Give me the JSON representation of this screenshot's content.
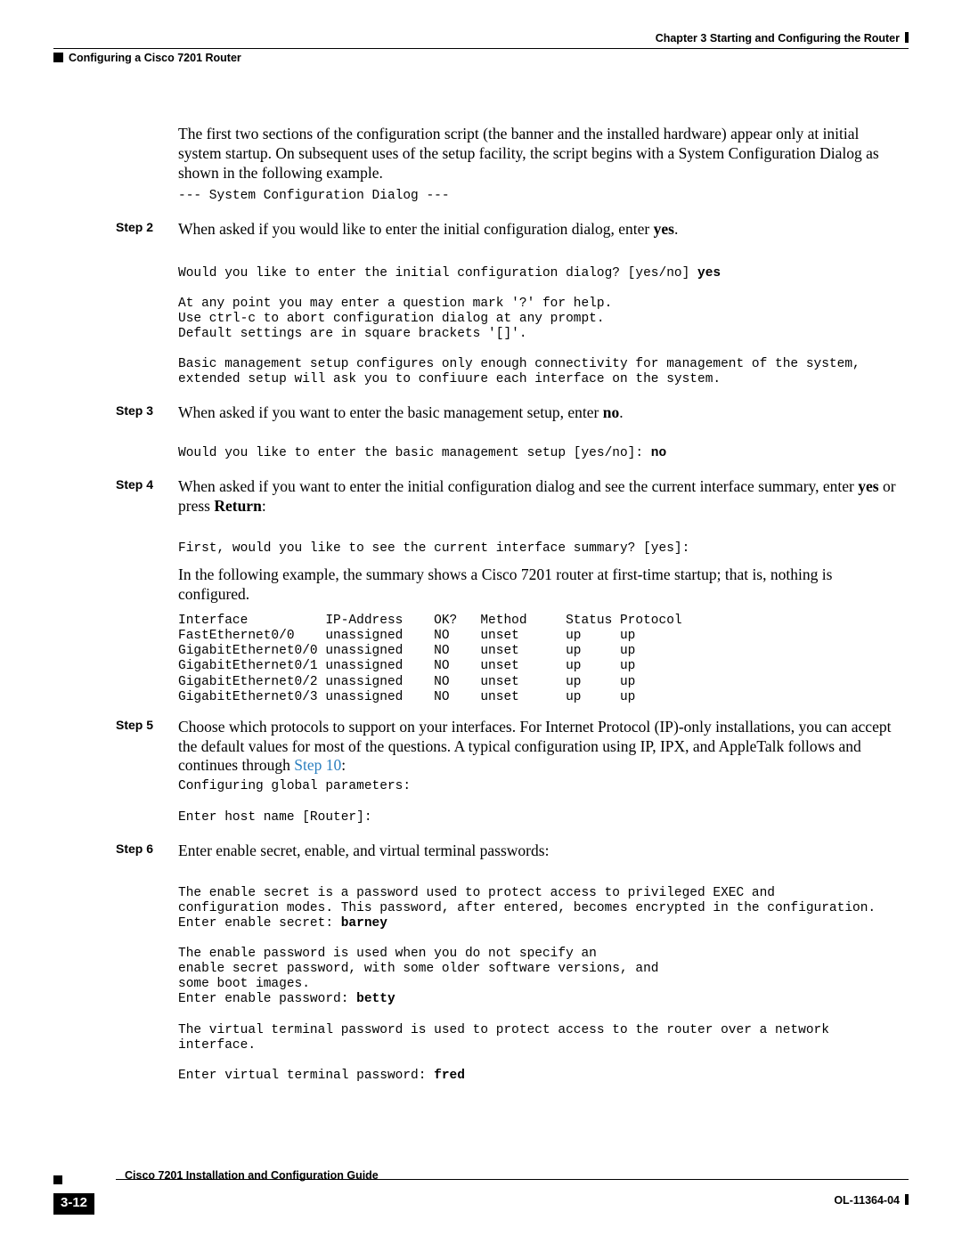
{
  "header": {
    "chapter": "Chapter 3     Starting and Configuring the Router",
    "section": "Configuring a Cisco 7201 Router"
  },
  "intro_para": "The first two sections of the configuration script (the banner and the installed hardware) appear only at initial system startup. On subsequent uses of the setup facility, the script begins with a System Configuration Dialog as shown in the following example.",
  "intro_mono": "--- System Configuration Dialog ---",
  "step2": {
    "label": "Step 2",
    "body_prefix": "When asked if you would like to enter the initial configuration dialog, enter ",
    "body_bold": "yes",
    "body_suffix": ".",
    "mono_line1": "Would you like to enter the initial configuration dialog? [yes/no] ",
    "mono_bold": "yes",
    "mono_rest": "\n\nAt any point you may enter a question mark '?' for help.\nUse ctrl-c to abort configuration dialog at any prompt.\nDefault settings are in square brackets '[]'.\n\nBasic management setup configures only enough connectivity for management of the system,\nextended setup will ask you to confiuure each interface on the system."
  },
  "step3": {
    "label": "Step 3",
    "body_prefix": "When asked if you want to enter the basic management setup, enter ",
    "body_bold": "no",
    "body_suffix": ".",
    "mono_line1": "Would you like to enter the basic management setup [yes/no]: ",
    "mono_bold": "no"
  },
  "step4": {
    "label": "Step 4",
    "body_prefix": "When asked if you want to enter the initial configuration dialog and see the current interface summary, enter ",
    "body_bold1": "yes",
    "body_mid": " or press ",
    "body_bold2": "Return",
    "body_suffix": ":",
    "mono1": "First, would you like to see the current interface summary? [yes]:",
    "para2": "In the following example, the summary shows a Cisco 7201 router at first-time startup; that is, nothing is configured.",
    "mono2": "Interface          IP-Address    OK?   Method     Status Protocol\nFastEthernet0/0    unassigned    NO    unset      up     up\nGigabitEthernet0/0 unassigned    NO    unset      up     up\nGigabitEthernet0/1 unassigned    NO    unset      up     up\nGigabitEthernet0/2 unassigned    NO    unset      up     up\nGigabitEthernet0/3 unassigned    NO    unset      up     up"
  },
  "step5": {
    "label": "Step 5",
    "body_prefix": "Choose which protocols to support on your interfaces. For Internet Protocol (IP)-only installations, you can accept the default values for most of the questions. A typical configuration using IP, IPX, and AppleTalk follows and continues through ",
    "body_link": "Step 10",
    "body_suffix": ":",
    "mono": "Configuring global parameters:\n\nEnter host name [Router]:"
  },
  "step6": {
    "label": "Step 6",
    "body": "Enter enable secret, enable, and virtual terminal passwords:",
    "mono_a1": "The enable secret is a password used to protect access to privileged EXEC and\nconfiguration modes. This password, after entered, becomes encrypted in the configuration.\nEnter enable secret: ",
    "mono_a1_bold": "barney",
    "mono_a2": "\n\nThe enable password is used when you do not specify an\nenable secret password, with some older software versions, and\nsome boot images.\nEnter enable password: ",
    "mono_a2_bold": "betty",
    "mono_a3": "\n\nThe virtual terminal password is used to protect access to the router over a network\ninterface.\n\nEnter virtual terminal password: ",
    "mono_a3_bold": "fred"
  },
  "footer": {
    "title": "Cisco 7201 Installation and Configuration Guide",
    "page": "3-12",
    "doc": "OL-11364-04"
  }
}
